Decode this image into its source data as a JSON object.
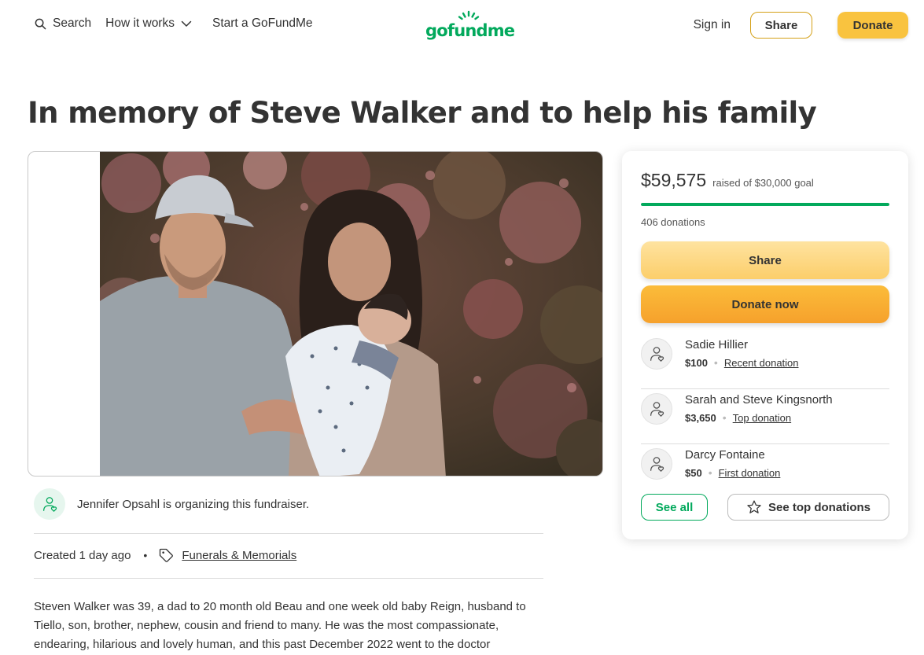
{
  "header": {
    "search_label": "Search",
    "how_it_works_label": "How it works",
    "start_label": "Start a GoFundMe",
    "logo_text": "gofundme",
    "signin_label": "Sign in",
    "share_label": "Share",
    "donate_label": "Donate"
  },
  "page": {
    "title": "In memory of Steve Walker and to help his family"
  },
  "organizer": {
    "text": "Jennifer Opsahl is organizing this fundraiser."
  },
  "meta": {
    "created": "Created 1 day ago",
    "dot": "•",
    "category": "Funerals & Memorials"
  },
  "story": {
    "text": "Steven Walker was 39, a dad to 20 month old Beau and one week old baby Reign, husband to Tiello, son, brother, nephew, cousin and friend to many. He was the most compassionate, endearing, hilarious and lovely human, and this past December 2022 went to the doctor"
  },
  "card": {
    "raised_amount": "$59,575",
    "raised_goal": "raised of $30,000 goal",
    "progress_fraction": 1.0,
    "donation_count": "406 donations",
    "share_label": "Share",
    "donate_now_label": "Donate now",
    "donors": [
      {
        "name": "Sadie Hillier",
        "amount": "$100",
        "type": "Recent donation"
      },
      {
        "name": "Sarah and Steve Kingsnorth",
        "amount": "$3,650",
        "type": "Top donation"
      },
      {
        "name": "Darcy Fontaine",
        "amount": "$50",
        "type": "First donation"
      }
    ],
    "see_all_label": "See all",
    "see_top_label": "See top donations"
  },
  "colors": {
    "brand_green": "#02a95c",
    "donate_yellow": "#f9c33f",
    "donate_orange": "#f6a12c",
    "text": "#333333"
  },
  "icons": {
    "search": "search-icon",
    "chevron": "chevron-down-icon",
    "tag": "tag-icon",
    "star": "star-icon",
    "donor": "donor-hand-heart-icon",
    "organizer": "organizer-hand-heart-icon"
  }
}
